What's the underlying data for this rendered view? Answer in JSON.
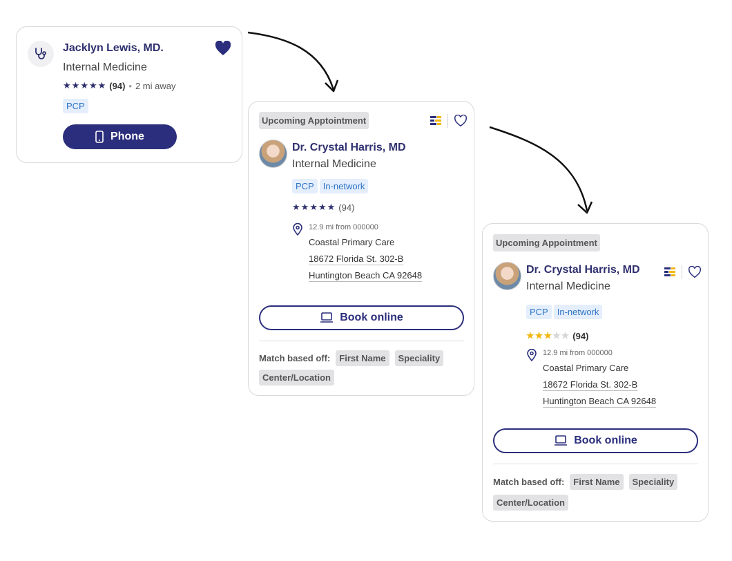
{
  "card1": {
    "name": "Jacklyn Lewis, MD.",
    "specialty": "Internal Medicine",
    "review_count": "(94)",
    "separator": "•",
    "distance": "2 mi away",
    "tag": "PCP",
    "phone_label": "Phone",
    "rating": 5,
    "icons": [
      "stethoscope-icon",
      "heart-filled-icon",
      "phone-icon"
    ]
  },
  "card2": {
    "badge": "Upcoming Apptointment",
    "name": "Dr. Crystal Harris, MD",
    "specialty": "Internal Medicine",
    "tags": [
      "PCP",
      "In-network"
    ],
    "review_count": "(94)",
    "rating": 5,
    "distance": "12.9 mi from 000000",
    "facility": "Coastal Primary Care",
    "address1": "18672 Florida St. 302-B",
    "address2": "Huntington Beach CA 92648",
    "book_label": "Book online",
    "match_label": "Match based off:",
    "match_tags": [
      "First Name",
      "Speciality",
      "Center/Location"
    ]
  },
  "card3": {
    "badge": "Upcoming Appointment",
    "name": "Dr. Crystal Harris, MD",
    "specialty": "Internal Medicine",
    "tags": [
      "PCP",
      "In-network"
    ],
    "review_count": "(94)",
    "rating": 3,
    "distance": "12.9 mi from 000000",
    "facility": "Coastal Primary Care",
    "address1": "18672 Florida St. 302-B",
    "address2": "Huntington Beach CA 92648",
    "book_label": "Book online",
    "match_label": "Match based off:",
    "match_tags": [
      "First Name",
      "Speciality",
      "Center/Location"
    ]
  },
  "colors": {
    "navy": "#2b2e7c",
    "tag_blue_bg": "#e4eefc",
    "tag_blue_text": "#2f74c7",
    "star_gold": "#f2b713",
    "gray_tag_bg": "#e2e2e4"
  }
}
